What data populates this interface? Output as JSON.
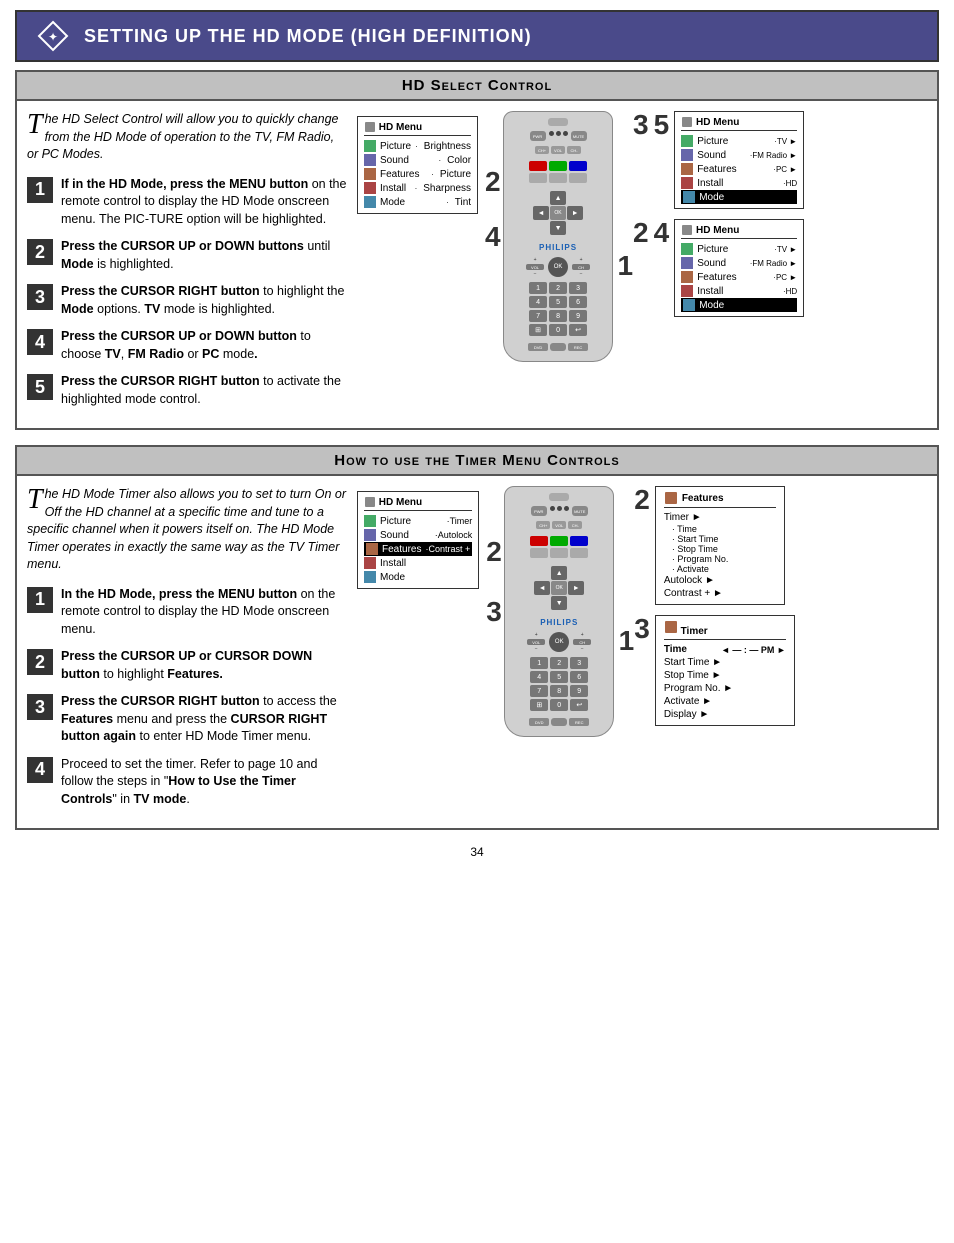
{
  "page": {
    "header_title": "Setting up the HD Mode (High Definition)",
    "page_number": "34"
  },
  "section1": {
    "title": "HD Select Control",
    "intro": "he HD Select Control will allow you to quickly change from the HD Mode of operation to the TV, FM Radio, or PC Modes.",
    "steps": [
      {
        "num": "1",
        "text": "If in the HD Mode, press the MENU button on the remote control to display the HD Mode onscreen menu. The PICTURE option will be highlighted."
      },
      {
        "num": "2",
        "text": "Press the CURSOR UP or DOWN buttons until Mode is highlighted."
      },
      {
        "num": "3",
        "text": "Press the CURSOR RIGHT button to highlight the Mode options. TV mode is highlighted."
      },
      {
        "num": "4",
        "text": "Press the CURSOR UP or DOWN button to choose TV, FM Radio or PC mode."
      },
      {
        "num": "5",
        "text": "Press the CURSOR RIGHT button to activate the highlighted mode control."
      }
    ],
    "menu1_title": "HD Menu",
    "menu1_items": [
      {
        "label": "Picture",
        "dot": "Brightness"
      },
      {
        "label": "Sound",
        "dot": "Color"
      },
      {
        "label": "Features",
        "dot": "Picture"
      },
      {
        "label": "Install",
        "dot": "Sharpness"
      },
      {
        "label": "Mode",
        "dot": "Tint"
      }
    ],
    "menu2_title": "HD Menu",
    "menu2_items": [
      {
        "label": "Picture",
        "sub": "TV"
      },
      {
        "label": "Sound",
        "sub": "FM Radio"
      },
      {
        "label": "Features",
        "sub": "PC"
      },
      {
        "label": "Install",
        "sub": "HD"
      },
      {
        "label": "Mode",
        "sub": ""
      }
    ],
    "menu3_title": "HD Menu",
    "menu3_items": [
      {
        "label": "Picture",
        "sub": "TV"
      },
      {
        "label": "Sound",
        "sub": "FM Radio"
      },
      {
        "label": "Features",
        "sub": "PC"
      },
      {
        "label": "Install",
        "sub": "HD"
      },
      {
        "label": "Mode",
        "sub": ""
      }
    ]
  },
  "section2": {
    "title": "How to use the Timer Menu Controls",
    "intro": "he HD Mode Timer also allows you to set to turn On or Off the HD channel at a specific time and tune to a specific channel when it powers itself on. The HD Mode Timer operates in exactly the same way as the TV Timer menu.",
    "steps": [
      {
        "num": "1",
        "text": "In the HD Mode, press the MENU button on the remote control to display the HD Mode onscreen menu."
      },
      {
        "num": "2",
        "text": "Press the CURSOR UP or CURSOR DOWN button to highlight Features."
      },
      {
        "num": "3",
        "text": "Press the CURSOR RIGHT button to access the Features menu and press the CURSOR RIGHT button again to enter HD Mode Timer menu."
      },
      {
        "num": "4",
        "text": "Proceed to set the timer. Refer to page 10 and follow the steps in \"How to Use the Timer Controls\" in TV mode."
      }
    ],
    "timer_menu_title": "HD Menu",
    "timer_menu_items": [
      {
        "label": "Picture",
        "dot": "Timer"
      },
      {
        "label": "Sound",
        "dot": "Autolock"
      },
      {
        "label": "Features",
        "dot": "Contrast +"
      },
      {
        "label": "Install",
        "dot": ""
      },
      {
        "label": "Mode",
        "dot": ""
      }
    ],
    "features_title": "Features",
    "features_items": [
      {
        "label": "Timer",
        "subs": [
          "Time",
          "Start Time",
          "Stop Time",
          "Program No.",
          "Activate"
        ]
      },
      {
        "label": "Autolock",
        "subs": []
      },
      {
        "label": "Contrast +",
        "subs": []
      }
    ],
    "timer_box_title": "Timer",
    "timer_box_items": [
      {
        "label": "Time",
        "value": "◄ — : — PM ►"
      },
      {
        "label": "Start Time",
        "arrow": "►"
      },
      {
        "label": "Stop Time",
        "arrow": "►"
      },
      {
        "label": "Program No.",
        "arrow": "►"
      },
      {
        "label": "Activate",
        "arrow": "►"
      },
      {
        "label": "Display",
        "arrow": "►"
      }
    ]
  }
}
